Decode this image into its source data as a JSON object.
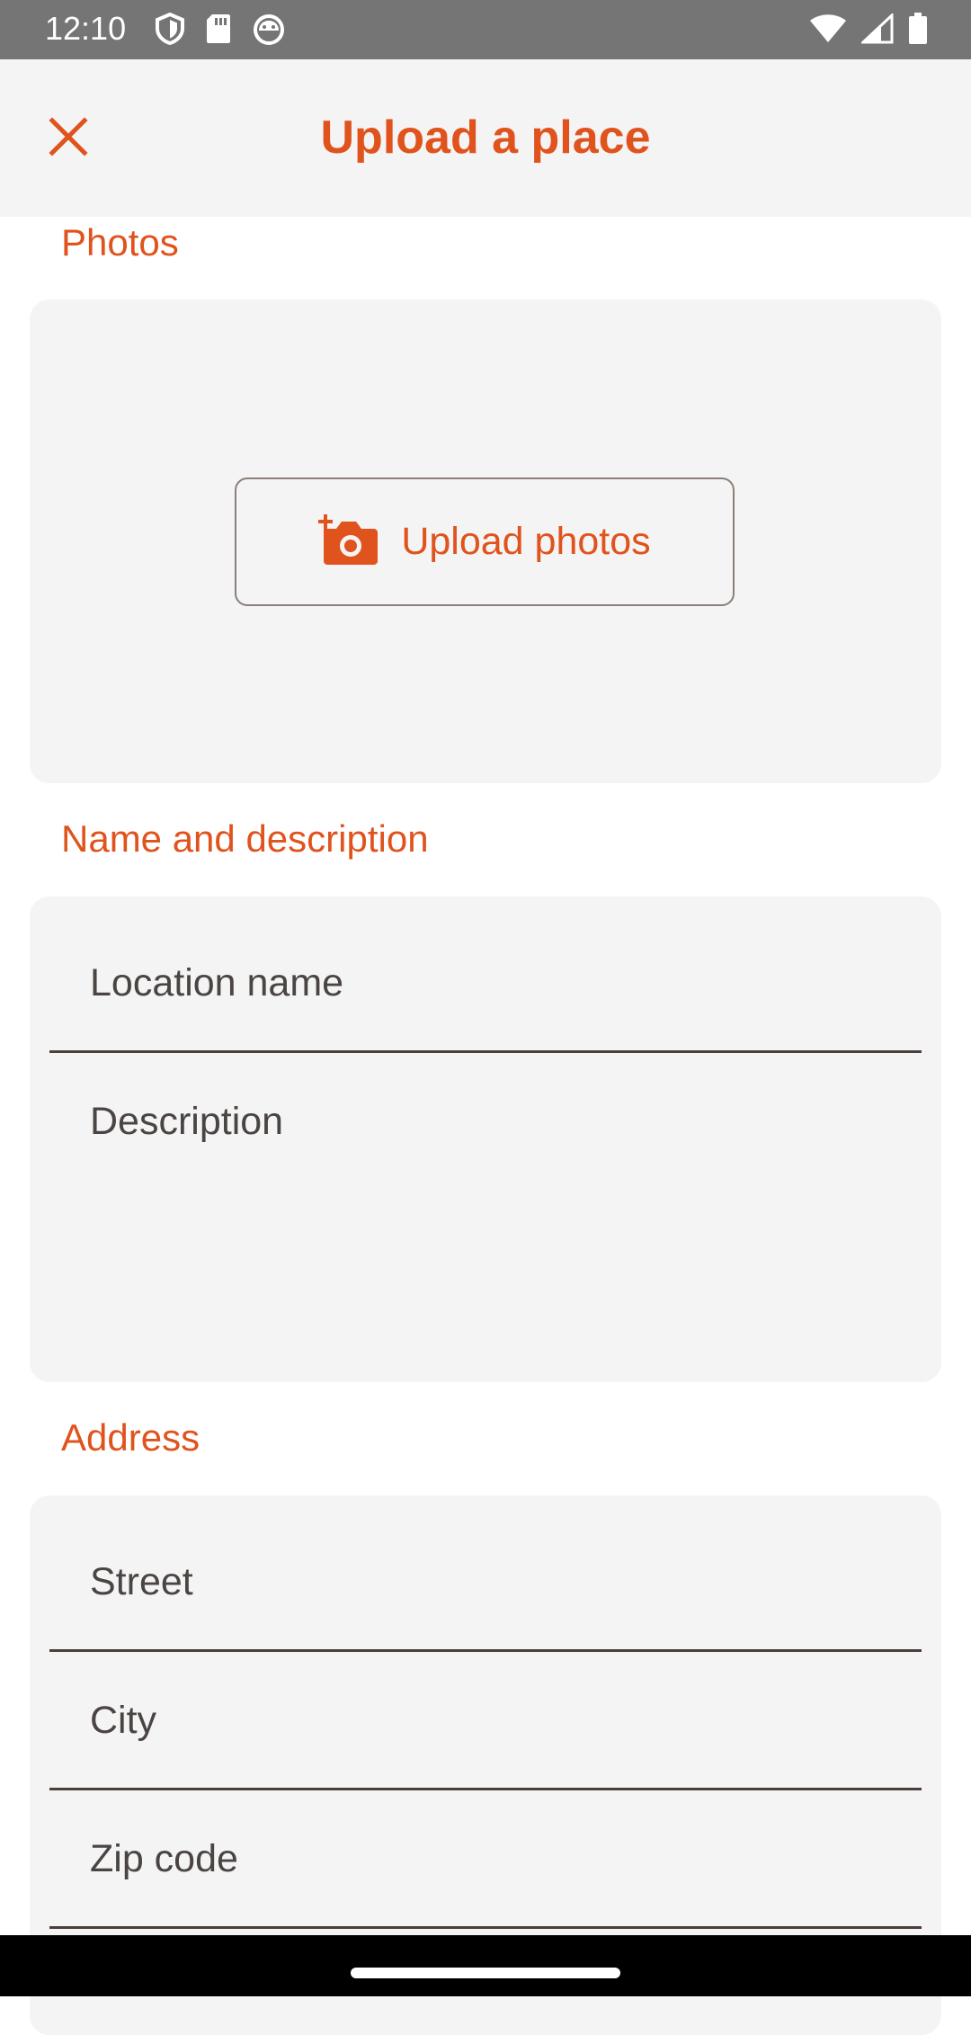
{
  "status_bar": {
    "time": "12:10",
    "left_icons": [
      "shield-icon",
      "sd-card-icon",
      "android-icon"
    ],
    "right_icons": [
      "wifi-icon",
      "signal-icon",
      "battery-icon"
    ]
  },
  "app_bar": {
    "title": "Upload a place",
    "close_icon": "close-icon"
  },
  "sections": {
    "photos": {
      "label": "Photos",
      "upload_button_label": "Upload photos",
      "upload_icon": "add-a-photo-icon"
    },
    "name_description": {
      "label": "Name and description",
      "location_name_placeholder": "Location name",
      "description_placeholder": "Description"
    },
    "address": {
      "label": "Address",
      "street_placeholder": "Street",
      "city_placeholder": "City",
      "zip_placeholder": "Zip code"
    }
  },
  "colors": {
    "accent": "#e0531d",
    "card_background": "#f4f4f4",
    "status_bar": "#757575",
    "text": "#4a4543"
  }
}
